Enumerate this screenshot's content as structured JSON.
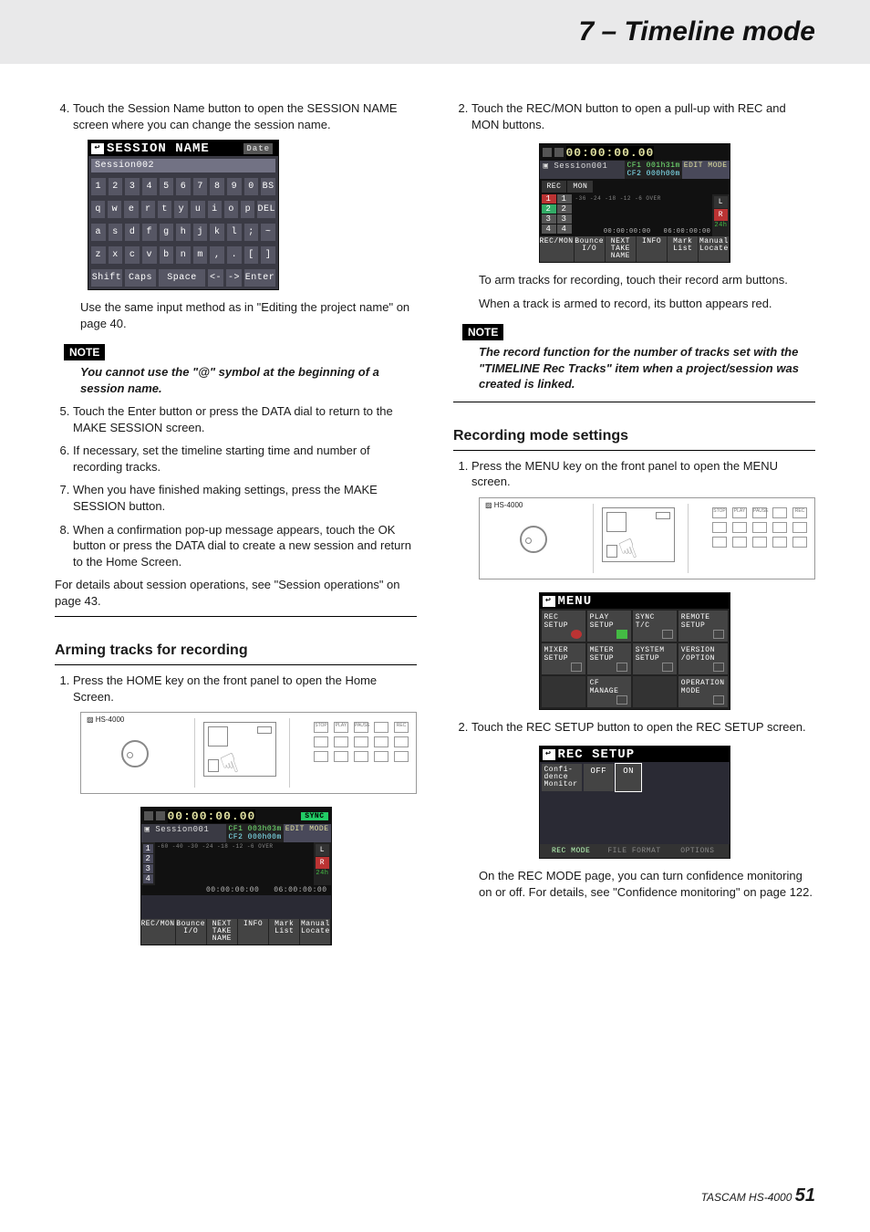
{
  "header": {
    "title": "7 – Timeline mode"
  },
  "left": {
    "step4": "Touch the Session Name button to open the SESSION NAME screen where you can change the session name.",
    "sessionName": {
      "title": "SESSION NAME",
      "tag": "Date",
      "value": "Session002",
      "rows": [
        [
          "1",
          "2",
          "3",
          "4",
          "5",
          "6",
          "7",
          "8",
          "9",
          "0",
          "BS"
        ],
        [
          "q",
          "w",
          "e",
          "r",
          "t",
          "y",
          "u",
          "i",
          "o",
          "p",
          "DEL"
        ],
        [
          "a",
          "s",
          "d",
          "f",
          "g",
          "h",
          "j",
          "k",
          "l",
          ";",
          "~"
        ],
        [
          "z",
          "x",
          "c",
          "v",
          "b",
          "n",
          "m",
          ",",
          ".",
          "[",
          "]"
        ]
      ],
      "bottom": [
        "Shift",
        "Caps",
        "Space",
        "<-",
        "->",
        "Enter"
      ]
    },
    "afterSessionName": "Use the same input method as in \"Editing the project name\" on page 40.",
    "noteLabel": "NOTE",
    "noteBody": "You cannot use the \"@\" symbol at the beginning of a session name.",
    "step5": "Touch the Enter button or press the DATA dial to return to the MAKE SESSION screen.",
    "step6": "If necessary, set the timeline starting time and number of recording tracks.",
    "step7": "When you have finished making settings, press the MAKE SESSION button.",
    "step8": "When a confirmation pop-up message appears, touch the OK button or press the DATA dial to create a new session and return to the Home Screen.",
    "detailsRef": "For details about session operations, see \"Session operations\" on page 43.",
    "armHeading": "Arming tracks for recording",
    "armStep1": "Press the HOME key on the front panel to open the Home Screen.",
    "hwLabel": "HS-4000",
    "home": {
      "time": "00:00:00.00",
      "sync": "SYNC",
      "session": "Session001",
      "cf1": "CF1  003h03m",
      "cf2": "CF2  000h00m",
      "editMode": "EDIT MODE",
      "tracks": [
        "1",
        "2",
        "3",
        "4"
      ],
      "scale": "-60 -40 -30   -24   -18  -12   -6   OVER",
      "lr": [
        "L",
        "R"
      ],
      "t1": "00:00:00:00",
      "t2": "06:00:00:00",
      "bot": [
        "REC/MON",
        "Bounce I/O",
        "NEXT TAKE NAME",
        "INFO",
        "Mark List",
        "Manual Locate"
      ]
    }
  },
  "right": {
    "step2a": "Touch the REC/MON button to open a pull-up with REC and MON buttons.",
    "recmon": {
      "time": "00:00:00.00",
      "session": "Session001",
      "cf1": "CF1  001h31m",
      "cf2": "CF2  000h00m",
      "editMode": "EDIT MODE",
      "cols": [
        "REC",
        "MON"
      ],
      "rows": [
        [
          "1",
          "1"
        ],
        [
          "2",
          "2"
        ],
        [
          "3",
          "3"
        ],
        [
          "4",
          "4"
        ]
      ],
      "scale": "-36   -24   -18  -12   -6   OVER",
      "lr": [
        "L",
        "R"
      ],
      "t1": "00:00:00:00",
      "t2": "06:00:00:00",
      "bot": [
        "REC/MON",
        "Bounce I/O",
        "NEXT TAKE NAME",
        "INFO",
        "Mark List",
        "Manual Locate"
      ]
    },
    "armNote1": "To arm tracks for recording, touch their record arm buttons.",
    "armNote2": "When a track is armed to record, its button appears red.",
    "noteLabel": "NOTE",
    "noteBody": "The record function for the number of tracks set with the \"TIMELINE Rec Tracks\" item when a project/session was created is linked.",
    "recModeHeading": "Recording mode settings",
    "recStep1": "Press the MENU key on the front panel to open the MENU screen.",
    "hwLabel": "HS-4000",
    "menu": {
      "title": "MENU",
      "cells": [
        {
          "l": "REC SETUP",
          "ic": "red"
        },
        {
          "l": "PLAY SETUP",
          "ic": "grn"
        },
        {
          "l": "SYNC T/C",
          "ic": ""
        },
        {
          "l": "REMOTE SETUP",
          "ic": ""
        },
        {
          "l": "MIXER SETUP",
          "ic": ""
        },
        {
          "l": "METER SETUP",
          "ic": ""
        },
        {
          "l": "SYSTEM SETUP",
          "ic": ""
        },
        {
          "l": "VERSION /OPTION",
          "ic": ""
        },
        {
          "l": "",
          "empty": true
        },
        {
          "l": "CF MANAGE",
          "ic": ""
        },
        {
          "l": "",
          "empty": true
        },
        {
          "l": "OPERATION MODE",
          "ic": ""
        }
      ]
    },
    "recStep2": "Touch the REC SETUP button to open the REC SETUP screen.",
    "recSetup": {
      "title": "REC SETUP",
      "row": {
        "label": "Confi- dence Monitor",
        "opts": [
          "OFF",
          "ON"
        ],
        "sel": 1
      },
      "tabs": [
        "REC MODE",
        "FILE FORMAT",
        "OPTIONS"
      ]
    },
    "after": "On the REC MODE page, you can turn confidence monitoring on or off. For details, see \"Confidence monitoring\" on page 122."
  },
  "footer": {
    "model": "TASCAM HS-4000",
    "page": "51"
  }
}
